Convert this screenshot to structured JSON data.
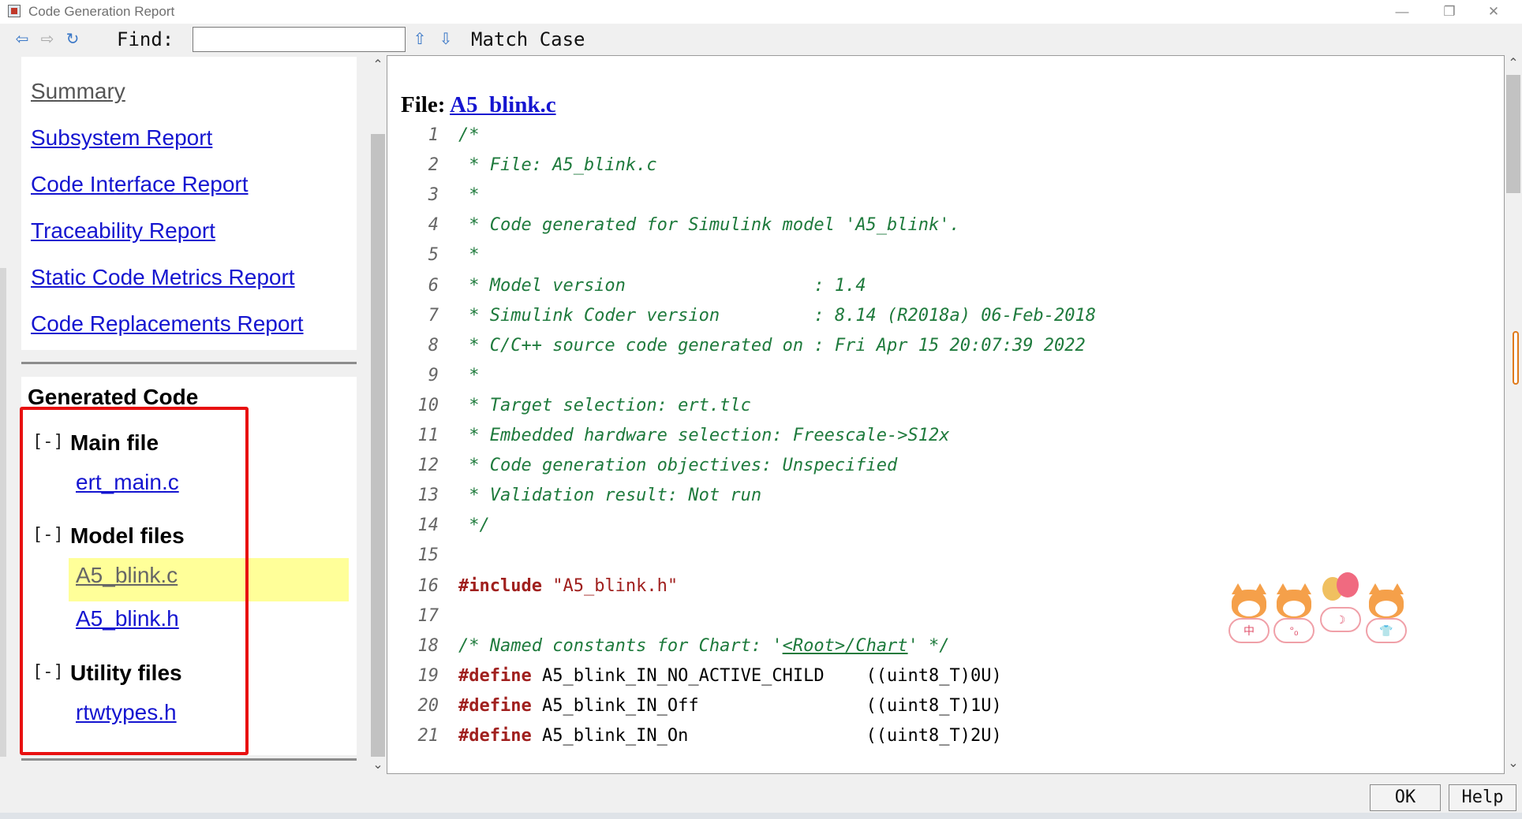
{
  "window": {
    "title": "Code Generation Report",
    "controls": {
      "minimize": "—",
      "restore": "❐",
      "close": "✕"
    }
  },
  "toolbar": {
    "back_icon": "back-arrow-icon",
    "forward_icon": "forward-arrow-icon",
    "refresh_icon": "refresh-icon",
    "find_label": "Find:",
    "find_value": "",
    "find_up_icon": "arrow-up-icon",
    "find_down_icon": "arrow-down-icon",
    "match_case": "Match Case"
  },
  "nav": {
    "links": [
      {
        "label": "Summary",
        "current": true
      },
      {
        "label": "Subsystem Report"
      },
      {
        "label": "Code Interface Report"
      },
      {
        "label": "Traceability Report"
      },
      {
        "label": "Static Code Metrics Report"
      },
      {
        "label": "Code Replacements Report"
      }
    ]
  },
  "generated_code": {
    "title": "Generated Code",
    "groups": [
      {
        "toggle": "[-]",
        "label": "Main file",
        "files": [
          "ert_main.c"
        ]
      },
      {
        "toggle": "[-]",
        "label": "Model files",
        "files": [
          "A5_blink.c",
          "A5_blink.h"
        ]
      },
      {
        "toggle": "[-]",
        "label": "Utility files",
        "files": [
          "rtwtypes.h"
        ]
      }
    ],
    "selected_file": "A5_blink.c"
  },
  "code_view": {
    "heading_prefix": "File: ",
    "heading_file": "A5_blink.c",
    "lines": [
      {
        "n": "1",
        "text": "/*"
      },
      {
        "n": "2",
        "text": " * File: A5_blink.c"
      },
      {
        "n": "3",
        "text": " *"
      },
      {
        "n": "4",
        "text": " * Code generated for Simulink model 'A5_blink'."
      },
      {
        "n": "5",
        "text": " *"
      },
      {
        "n": "6",
        "text": " * Model version                  : 1.4"
      },
      {
        "n": "7",
        "text": " * Simulink Coder version         : 8.14 (R2018a) 06-Feb-2018"
      },
      {
        "n": "8",
        "text": " * C/C++ source code generated on : Fri Apr 15 20:07:39 2022"
      },
      {
        "n": "9",
        "text": " *"
      },
      {
        "n": "10",
        "text": " * Target selection: ert.tlc"
      },
      {
        "n": "11",
        "text": " * Embedded hardware selection: Freescale->S12x"
      },
      {
        "n": "12",
        "text": " * Code generation objectives: Unspecified"
      },
      {
        "n": "13",
        "text": " * Validation result: Not run"
      },
      {
        "n": "14",
        "text": " */"
      },
      {
        "n": "15",
        "text": ""
      },
      {
        "n": "16",
        "directive": "#include",
        "rest": " \"A5_blink.h\""
      },
      {
        "n": "17",
        "text": ""
      },
      {
        "n": "18",
        "c_pre": "/* Named constants for Chart: '",
        "c_link": "<Root>/Chart",
        "c_post": "' */"
      },
      {
        "n": "19",
        "directive": "#define",
        "rest": " A5_blink_IN_NO_ACTIVE_CHILD    ((uint8_T)0U)"
      },
      {
        "n": "20",
        "directive": "#define",
        "rest": " A5_blink_IN_Off                ((uint8_T)1U)"
      },
      {
        "n": "21",
        "directive": "#define",
        "rest": " A5_blink_IN_On                 ((uint8_T)2U)"
      }
    ]
  },
  "decoration": {
    "mascot_clouds": [
      "中",
      "°ₒ",
      "☽",
      "👕"
    ]
  },
  "buttons": {
    "ok": "OK",
    "help": "Help"
  }
}
